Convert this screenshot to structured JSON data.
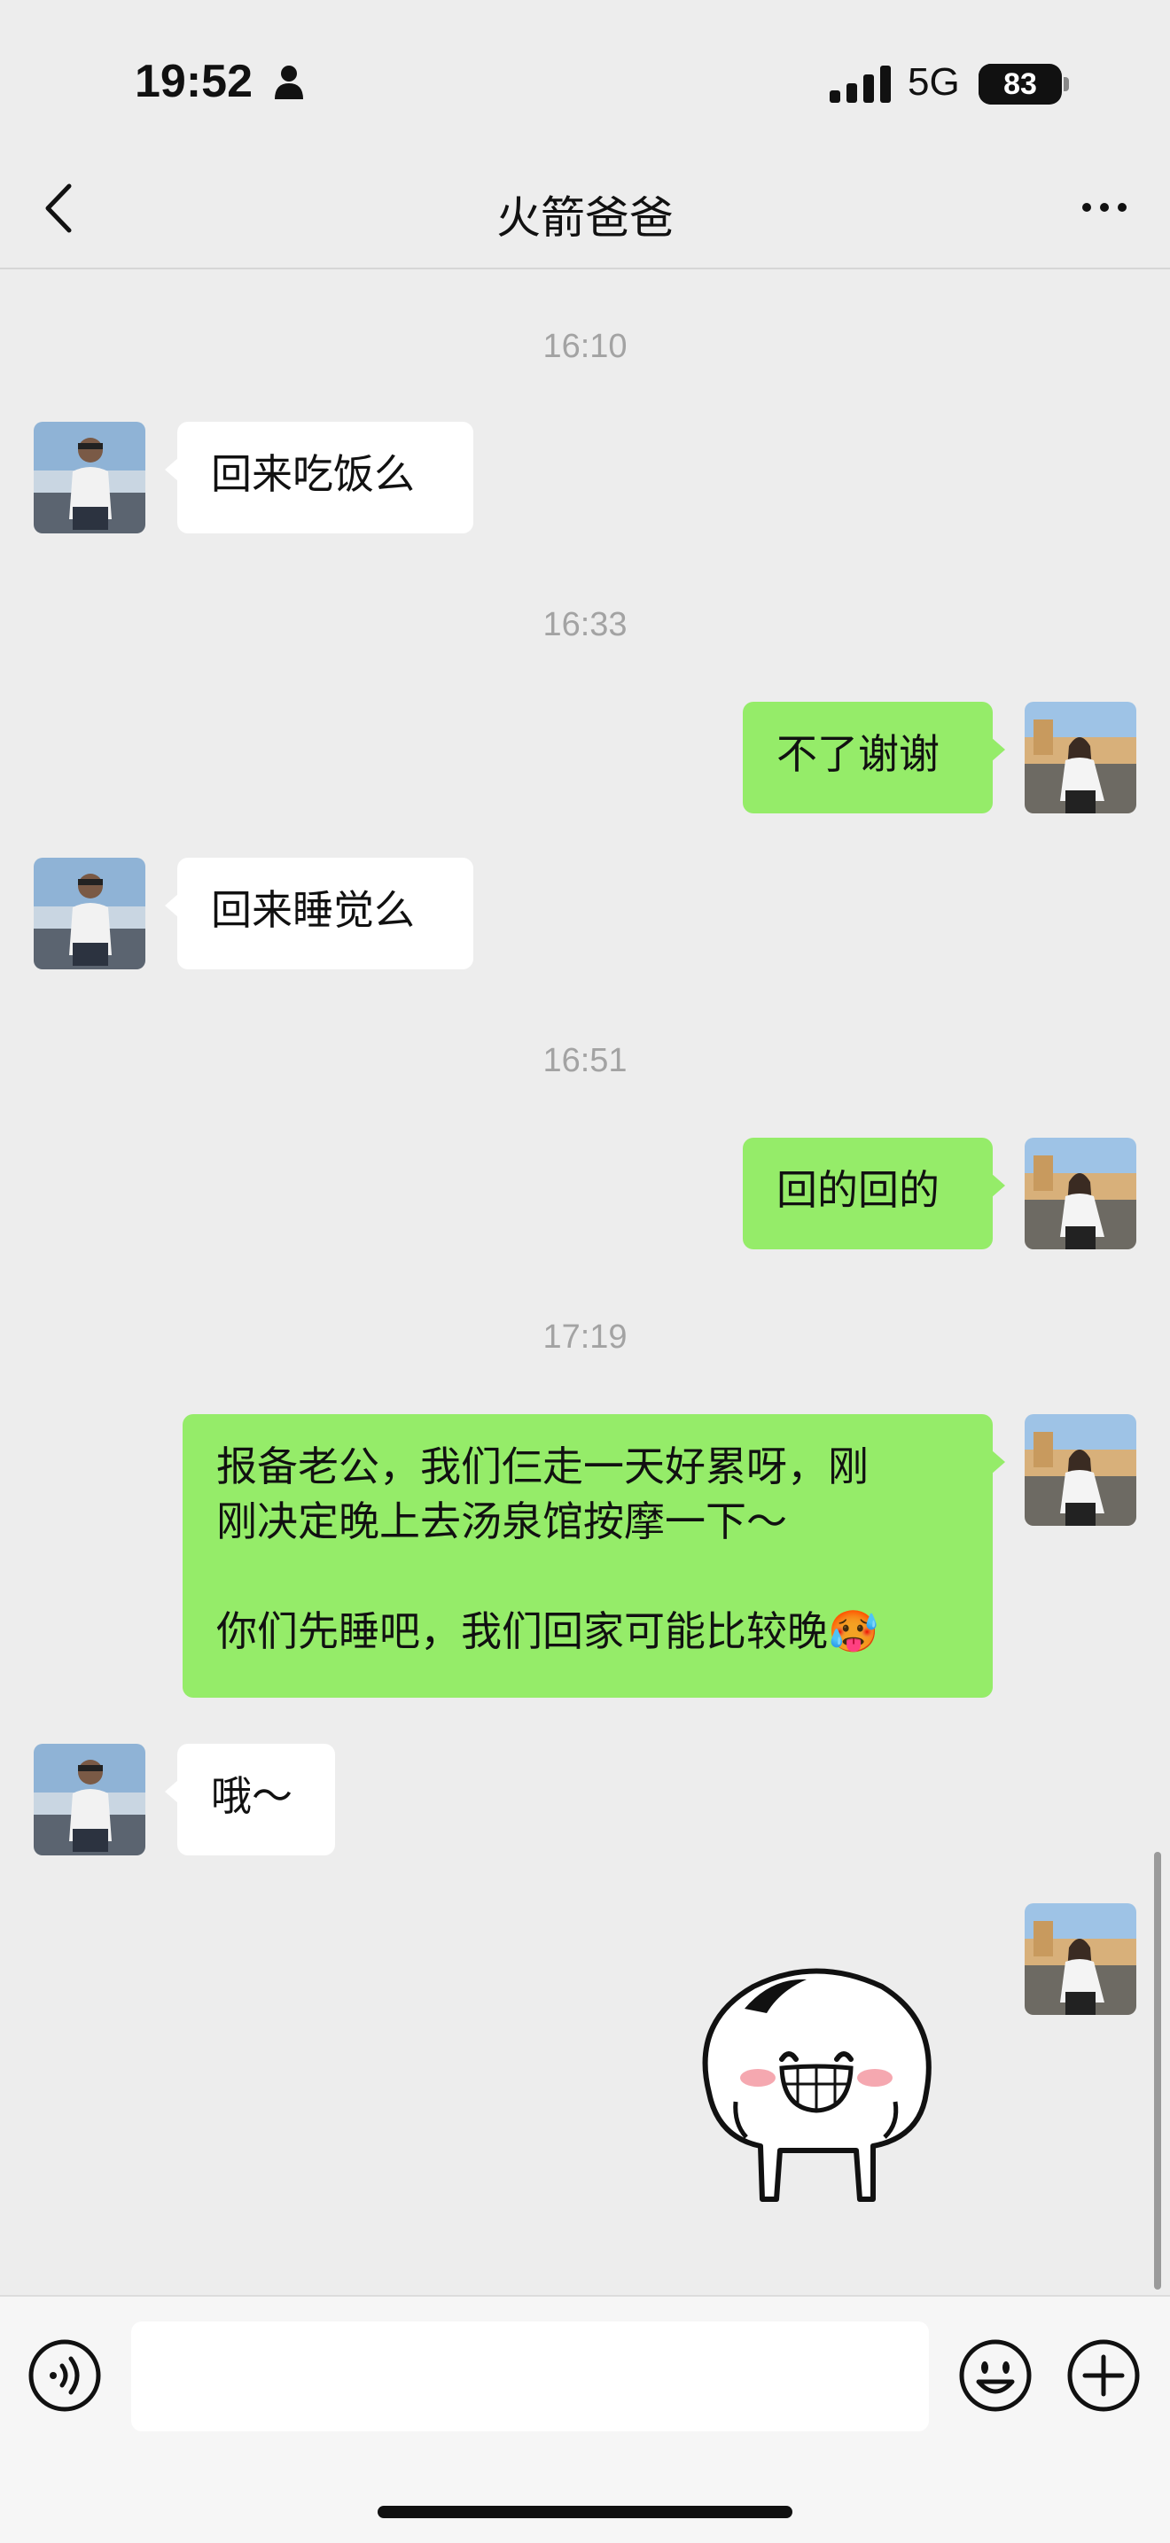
{
  "status_bar": {
    "time": "19:52",
    "network": "5G",
    "battery": "83",
    "battery_level": 0.83
  },
  "nav": {
    "title": "火箭爸爸",
    "back_icon": "chevron-left-icon",
    "more_icon": "more-dots-icon"
  },
  "messages": {
    "ts1": "16:10",
    "m1": "回来吃饭么",
    "ts2": "16:33",
    "m2": "不了谢谢",
    "m3": "回来睡觉么",
    "ts3": "16:51",
    "m4": "回的回的",
    "ts4": "17:19",
    "m5_line1": "报备老公，我们仨走一天好累呀，刚",
    "m5_line2": "刚决定晚上去汤泉馆按摩一下～",
    "m5_line3": "你们先睡吧，我们回家可能比较晚🥵",
    "m6": "哦～",
    "m7_sticker": "grinning-bun-sticker"
  },
  "input_bar": {
    "voice_icon": "voice-icon",
    "emoji_icon": "emoji-icon",
    "plus_icon": "plus-icon",
    "placeholder": ""
  },
  "colors": {
    "background": "#ededed",
    "outgoing_bubble": "#95ec69",
    "incoming_bubble": "#ffffff"
  }
}
